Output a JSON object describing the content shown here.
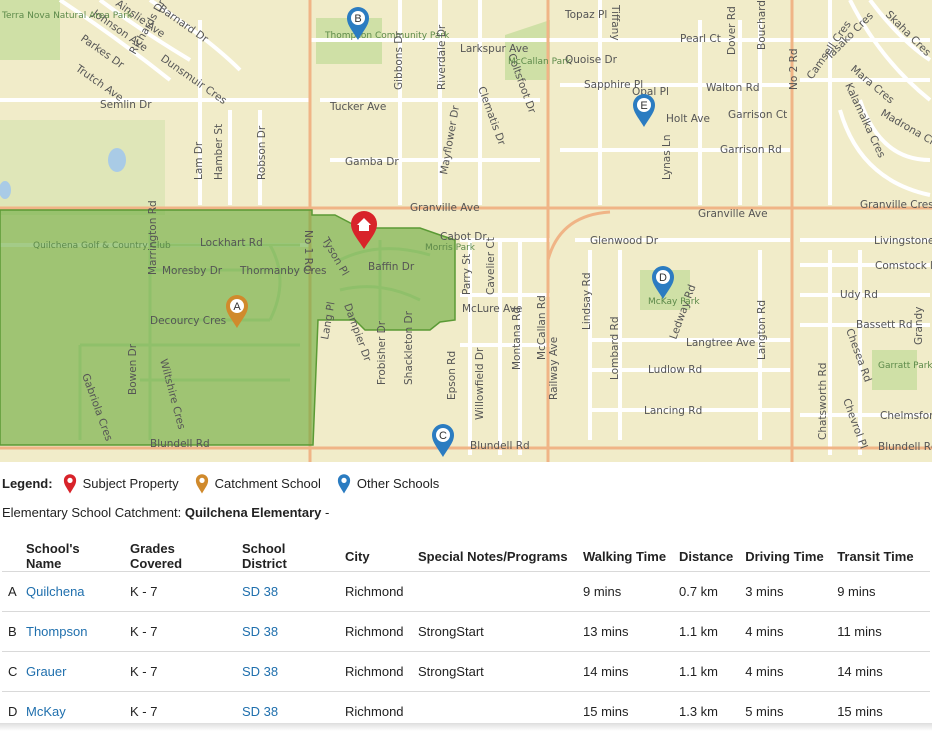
{
  "map": {
    "streets": [
      "Johnson Ave",
      "Barnard Dr",
      "Ainslie Ave",
      "Parkes Dr",
      "Richards Dr",
      "Dunsmuir Cres",
      "Trutch Ave",
      "Semlin Dr",
      "Thompson Community Park",
      "Tucker Ave",
      "Gibbons Dr",
      "Riverdale Dr",
      "Mayflower Dr",
      "Larkspur Ave",
      "Clematis Dr",
      "Coltsfoot Dr",
      "McCallan Park",
      "Topaz Pl",
      "Tiffany",
      "Quoise Dr",
      "Sapphire Pl",
      "Opal Pl",
      "Pearl Ct",
      "Walton Rd",
      "Dover Rd",
      "Bouchard",
      "No 2 Rd",
      "Camsell Cres",
      "Tasako Cres",
      "Skaha Cres",
      "Mara Cres",
      "Kalamalka Cres",
      "Madrona Cres",
      "Holt Ave",
      "Garrison Ct",
      "Garrison Rd",
      "Lynas Ln",
      "Gamba Dr",
      "Lam Dr",
      "Hamber St",
      "Robson Dr",
      "Granville Ave",
      "Granville Cres",
      "Livingstone",
      "Comstock Rd",
      "Udy Rd",
      "Bassett Rd",
      "Quilchena Golf & Country Club",
      "Marrington Rd",
      "Lockhart Rd",
      "Moresby Dr",
      "Thormanby Cres",
      "No 1 Rd",
      "Tyson Pl",
      "Cabot Dr",
      "Morris Park",
      "Baffin Dr",
      "Parry St",
      "Cavelier Ct",
      "McLure Ave",
      "Decourcy Cres",
      "Lang Pl",
      "Dampier Dr",
      "Frobisher Dr",
      "Shackleton Dr",
      "Epson Rd",
      "Willowfield Dr",
      "Montana Rd",
      "McCallan Rd",
      "Railway Ave",
      "Lindsay Rd",
      "Lombard Rd",
      "Ledway Rd",
      "McKay Park",
      "Langtree Ave",
      "Langton Rd",
      "Ludlow Rd",
      "Lancing Rd",
      "Chatsworth Rd",
      "Chesea Rd",
      "Garratt Park",
      "Chelmsford",
      "Bowen Dr",
      "Wiltshire Cres",
      "Gabriola Cres",
      "Blundell Rd",
      "Glenwood Dr",
      "Terra Nova Natural Area Park",
      "Chevrol Pl",
      "Grandy"
    ],
    "markers": [
      {
        "letter": "A",
        "type": "catchment"
      },
      {
        "letter": "B",
        "type": "other"
      },
      {
        "letter": "C",
        "type": "other"
      },
      {
        "letter": "D",
        "type": "other"
      },
      {
        "letter": "E",
        "type": "other"
      }
    ]
  },
  "legend": {
    "title": "Legend:",
    "items": [
      "Subject Property",
      "Catchment School",
      "Other Schools"
    ],
    "colors": {
      "subject": "#d8232a",
      "catchment": "#d08a2c",
      "other": "#2b7cc1"
    }
  },
  "catchment": {
    "label": "Elementary School Catchment:",
    "school": "Quilchena Elementary",
    "suffix": "-"
  },
  "table": {
    "headers": [
      "School's Name",
      "Grades Covered",
      "School District",
      "City",
      "Special Notes/Programs",
      "Walking Time",
      "Distance",
      "Driving Time",
      "Transit Time"
    ],
    "rows": [
      {
        "letter": "A",
        "name": "Quilchena",
        "grades": "K - 7",
        "district": "SD 38",
        "city": "Richmond",
        "notes": "",
        "walking": "9 mins",
        "distance": "0.7 km",
        "driving": "3 mins",
        "transit": "9 mins"
      },
      {
        "letter": "B",
        "name": "Thompson",
        "grades": "K - 7",
        "district": "SD 38",
        "city": "Richmond",
        "notes": "StrongStart",
        "walking": "13 mins",
        "distance": "1.1 km",
        "driving": "4 mins",
        "transit": "11 mins"
      },
      {
        "letter": "C",
        "name": "Grauer",
        "grades": "K - 7",
        "district": "SD 38",
        "city": "Richmond",
        "notes": "StrongStart",
        "walking": "14 mins",
        "distance": "1.1 km",
        "driving": "4 mins",
        "transit": "14 mins"
      },
      {
        "letter": "D",
        "name": "McKay",
        "grades": "K - 7",
        "district": "SD 38",
        "city": "Richmond",
        "notes": "",
        "walking": "15 mins",
        "distance": "1.3 km",
        "driving": "5 mins",
        "transit": "15 mins"
      }
    ]
  }
}
